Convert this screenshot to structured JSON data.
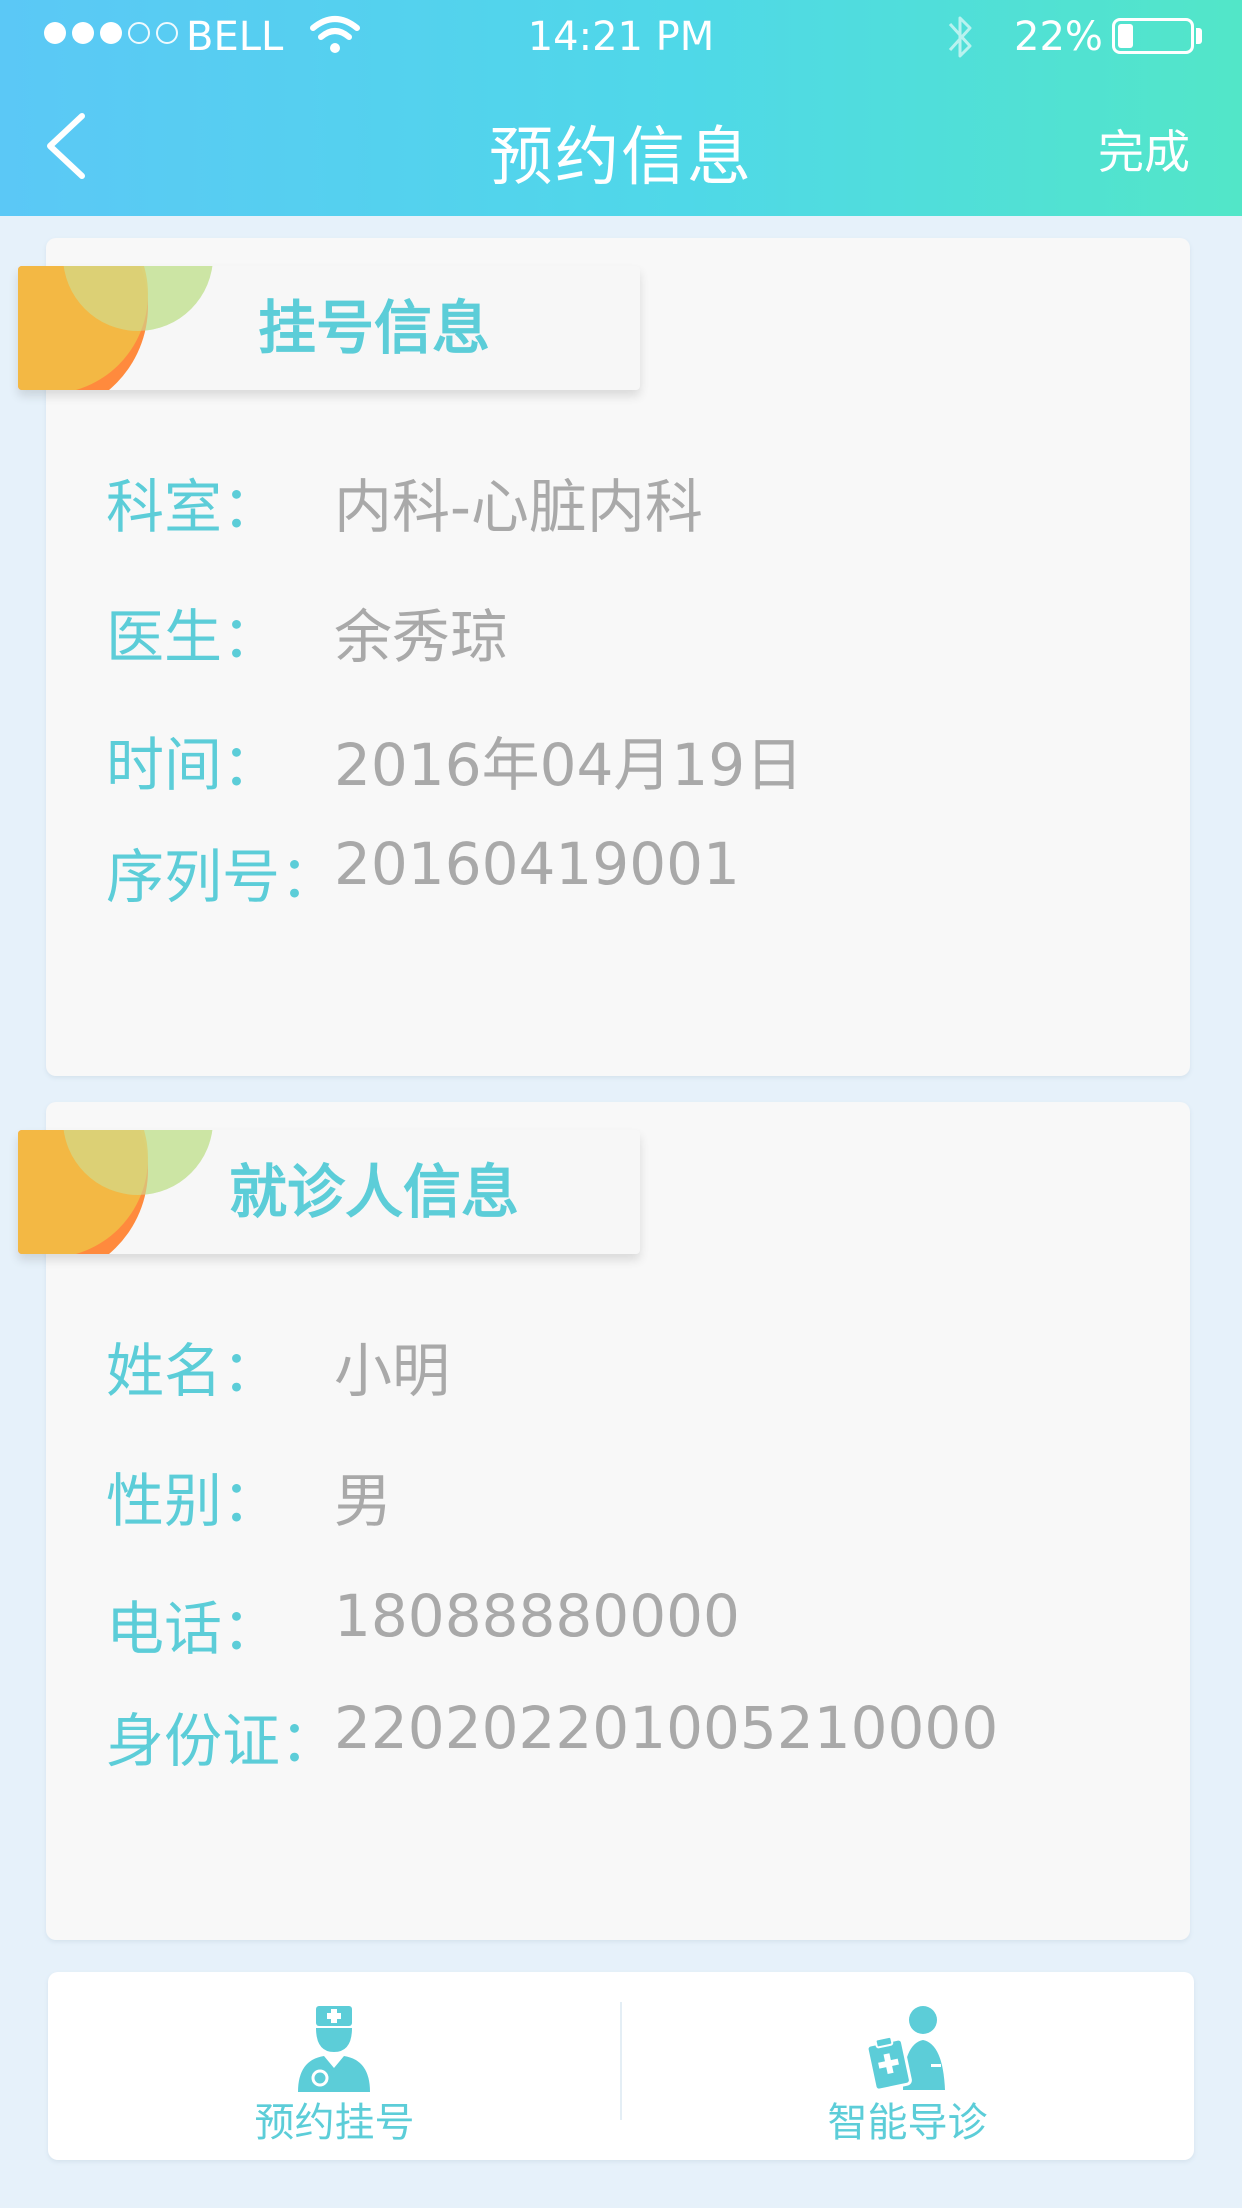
{
  "status_bar": {
    "carrier": "BELL",
    "time": "14:21 PM",
    "battery": "22%",
    "battery_level": 0.22
  },
  "nav": {
    "title": "预约信息",
    "done_label": "完成"
  },
  "register_info": {
    "title": "挂号信息",
    "rows": [
      {
        "label": "科室：",
        "value": "内科-心脏内科"
      },
      {
        "label": "医生：",
        "value": "余秀琼"
      },
      {
        "label": "时间：",
        "value": "2016年04月19日"
      },
      {
        "label": "序列号：",
        "value": "20160419001"
      }
    ]
  },
  "patient_info": {
    "title": "就诊人信息",
    "rows": [
      {
        "label": "姓名：",
        "value": "小明"
      },
      {
        "label": "性别：",
        "value": "男"
      },
      {
        "label": "电话：",
        "value": "18088880000"
      },
      {
        "label": "身份证：",
        "value": "220202201005210000"
      }
    ]
  },
  "bottom_bar": {
    "items": [
      {
        "label": "预约挂号",
        "icon": "doctor-icon"
      },
      {
        "label": "智能导诊",
        "icon": "guide-icon"
      }
    ]
  },
  "colors": {
    "accent": "#5ccdd8",
    "value_text": "#a9a9a9"
  }
}
